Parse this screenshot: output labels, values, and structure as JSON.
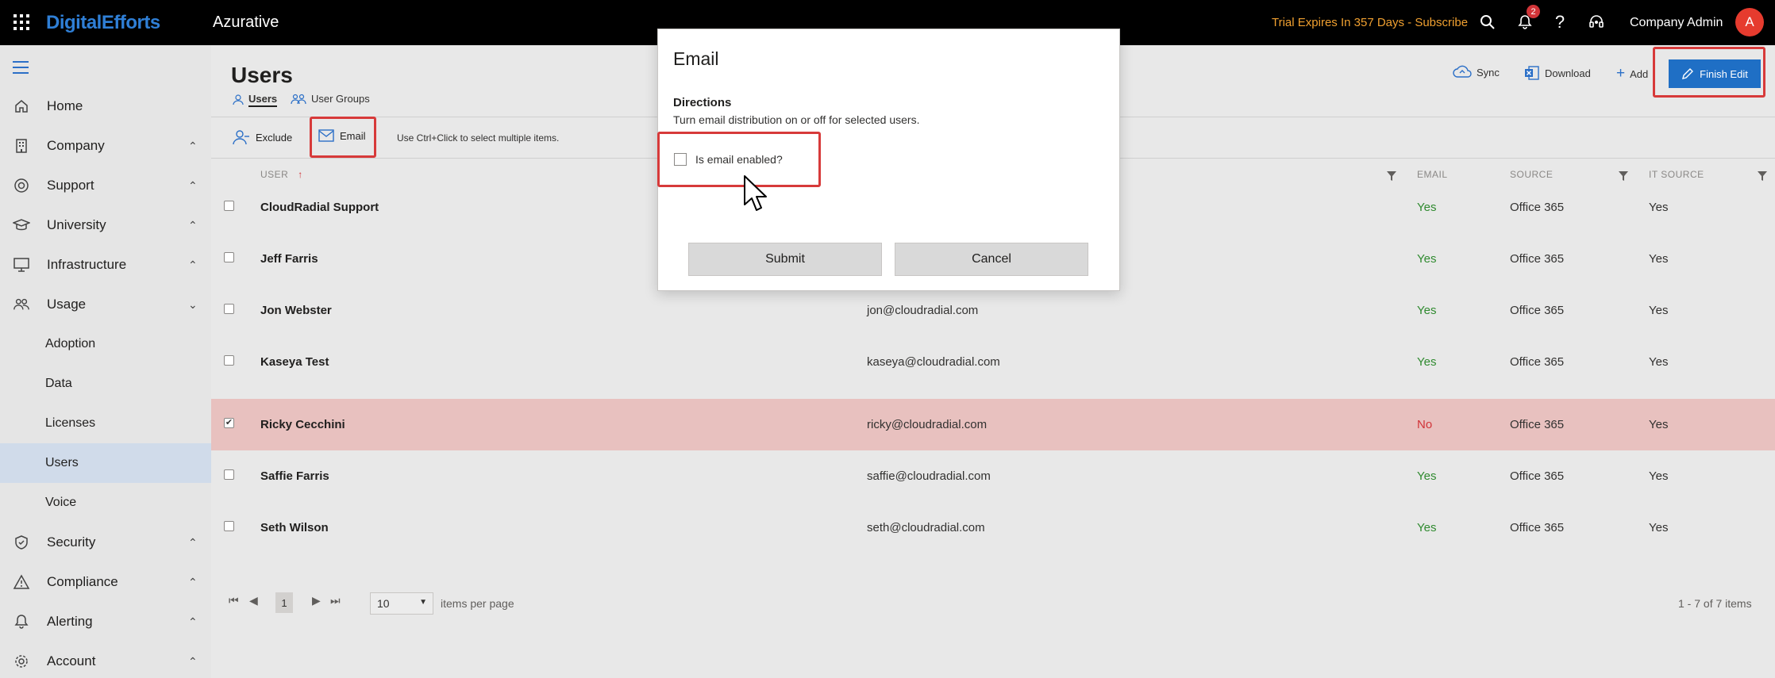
{
  "topbar": {
    "brand": "DigitalEfforts",
    "tenant": "Azurative",
    "trial_notice": "Trial Expires In 357 Days - Subscribe",
    "notification_count": "2",
    "user_name": "Company Admin",
    "avatar_initial": "A"
  },
  "sidebar": {
    "items": [
      {
        "label": "Home",
        "icon": "home-icon",
        "chevron": ""
      },
      {
        "label": "Company",
        "icon": "building-icon",
        "chevron": "up"
      },
      {
        "label": "Support",
        "icon": "lifebuoy-icon",
        "chevron": "up"
      },
      {
        "label": "University",
        "icon": "graduation-cap-icon",
        "chevron": "up"
      },
      {
        "label": "Infrastructure",
        "icon": "monitor-icon",
        "chevron": "up"
      },
      {
        "label": "Usage",
        "icon": "people-icon",
        "chevron": "down"
      }
    ],
    "usage_sub": [
      {
        "label": "Adoption"
      },
      {
        "label": "Data"
      },
      {
        "label": "Licenses"
      },
      {
        "label": "Users",
        "active": true
      },
      {
        "label": "Voice"
      }
    ],
    "items_after": [
      {
        "label": "Security",
        "icon": "shield-icon",
        "chevron": "up"
      },
      {
        "label": "Compliance",
        "icon": "warning-icon",
        "chevron": "up"
      },
      {
        "label": "Alerting",
        "icon": "bell-icon",
        "chevron": "up"
      },
      {
        "label": "Account",
        "icon": "gear-icon",
        "chevron": "up"
      }
    ]
  },
  "page": {
    "title": "Users",
    "tabs": [
      {
        "label": "Users",
        "active": true
      },
      {
        "label": "User Groups",
        "active": false
      }
    ],
    "commands": {
      "exclude": "Exclude",
      "email": "Email",
      "hint": "Use Ctrl+Click to select multiple items."
    },
    "actions": {
      "sync": "Sync",
      "download": "Download",
      "add": "Add",
      "finish_edit": "Finish Edit"
    }
  },
  "table": {
    "columns": {
      "user": "USER",
      "email": "EMAIL",
      "source": "SOURCE",
      "it_source": "IT SOURCE"
    },
    "rows": [
      {
        "name": "CloudRadial Support",
        "email": "",
        "enabled": "Yes",
        "source": "Office 365",
        "it_source": "Yes",
        "selected": false
      },
      {
        "name": "Jeff Farris",
        "email": "",
        "enabled": "Yes",
        "source": "Office 365",
        "it_source": "Yes",
        "selected": false
      },
      {
        "name": "Jon Webster",
        "email": "jon@cloudradial.com",
        "enabled": "Yes",
        "source": "Office 365",
        "it_source": "Yes",
        "selected": false
      },
      {
        "name": "Kaseya Test",
        "email": "kaseya@cloudradial.com",
        "enabled": "Yes",
        "source": "Office 365",
        "it_source": "Yes",
        "selected": false
      },
      {
        "name": "Ricky Cecchini",
        "email": "ricky@cloudradial.com",
        "enabled": "No",
        "source": "Office 365",
        "it_source": "Yes",
        "selected": true
      },
      {
        "name": "Saffie Farris",
        "email": "saffie@cloudradial.com",
        "enabled": "Yes",
        "source": "Office 365",
        "it_source": "Yes",
        "selected": false
      },
      {
        "name": "Seth Wilson",
        "email": "seth@cloudradial.com",
        "enabled": "Yes",
        "source": "Office 365",
        "it_source": "Yes",
        "selected": false
      }
    ]
  },
  "pager": {
    "current_page": "1",
    "page_size": "10",
    "items_per_page_label": "items per page",
    "count_label": "1 - 7 of 7 items"
  },
  "dialog": {
    "title": "Email",
    "section": "Directions",
    "description": "Turn email distribution on or off for selected users.",
    "checkbox_label": "Is email enabled?",
    "checkbox_checked": false,
    "submit": "Submit",
    "cancel": "Cancel"
  },
  "colors": {
    "accent": "#1f6fc5",
    "highlight": "#d73a3a",
    "selected_row": "#e8c1bf",
    "yes": "#2f8a2f",
    "no": "#d13438"
  }
}
